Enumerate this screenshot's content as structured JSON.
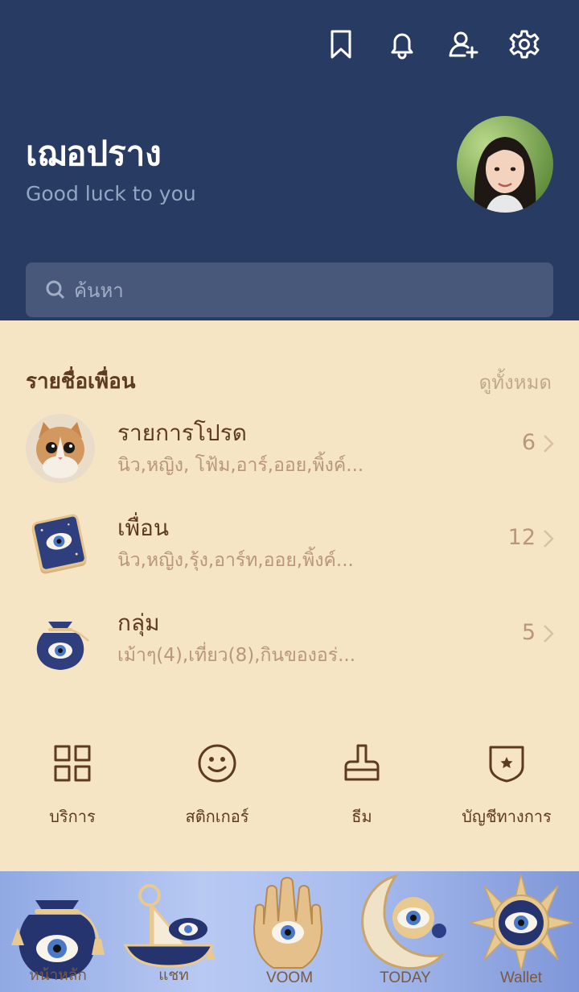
{
  "header": {
    "icons": [
      "bookmark-icon",
      "bell-icon",
      "add-friend-icon",
      "gear-icon"
    ],
    "colors": {
      "background": "#283b63",
      "text": "#ffffff"
    }
  },
  "profile": {
    "name": "เฌอปราง",
    "status": "Good luck to you"
  },
  "search": {
    "placeholder": "ค้นหา"
  },
  "friends_section": {
    "title": "รายชื่อเพื่อน",
    "see_all": "ดูทั้งหมด",
    "rows": [
      {
        "title": "รายการโปรด",
        "subtitle": "นิว,หญิง, โฟ้ม,อาร์,ออย,พิ้งค์...",
        "count": "6",
        "icon": "cat-avatar-icon"
      },
      {
        "title": "เพื่อน",
        "subtitle": "นิว,หญิง,รุ้ง,อาร์ท,ออย,พิ้งค์...",
        "count": "12",
        "icon": "evil-eye-book-icon"
      },
      {
        "title": "กลุ่ม",
        "subtitle": "เม้าๆ(4),เที่ยว(8),กินของอร่...",
        "count": "5",
        "icon": "evil-eye-pouch-icon"
      }
    ]
  },
  "shortcuts": [
    {
      "label": "บริการ",
      "icon": "grid-icon"
    },
    {
      "label": "สติกเกอร์",
      "icon": "smiley-icon"
    },
    {
      "label": "ธีม",
      "icon": "brush-icon"
    },
    {
      "label": "บัญชีทางการ",
      "icon": "shield-star-icon"
    }
  ],
  "tabbar": {
    "tabs": [
      {
        "label": "หน้าหลัก",
        "icon": "evil-eye-pouch-icon"
      },
      {
        "label": "แชท",
        "icon": "evil-eye-boat-icon"
      },
      {
        "label": "VOOM",
        "icon": "hamsa-hand-icon"
      },
      {
        "label": "TODAY",
        "icon": "crescent-moon-eye-icon"
      },
      {
        "label": "Wallet",
        "icon": "sun-eye-icon"
      }
    ]
  },
  "colors": {
    "body_background": "#f5e5c4",
    "accent_brown": "#5e3a22",
    "muted_brown": "#b9967c"
  }
}
